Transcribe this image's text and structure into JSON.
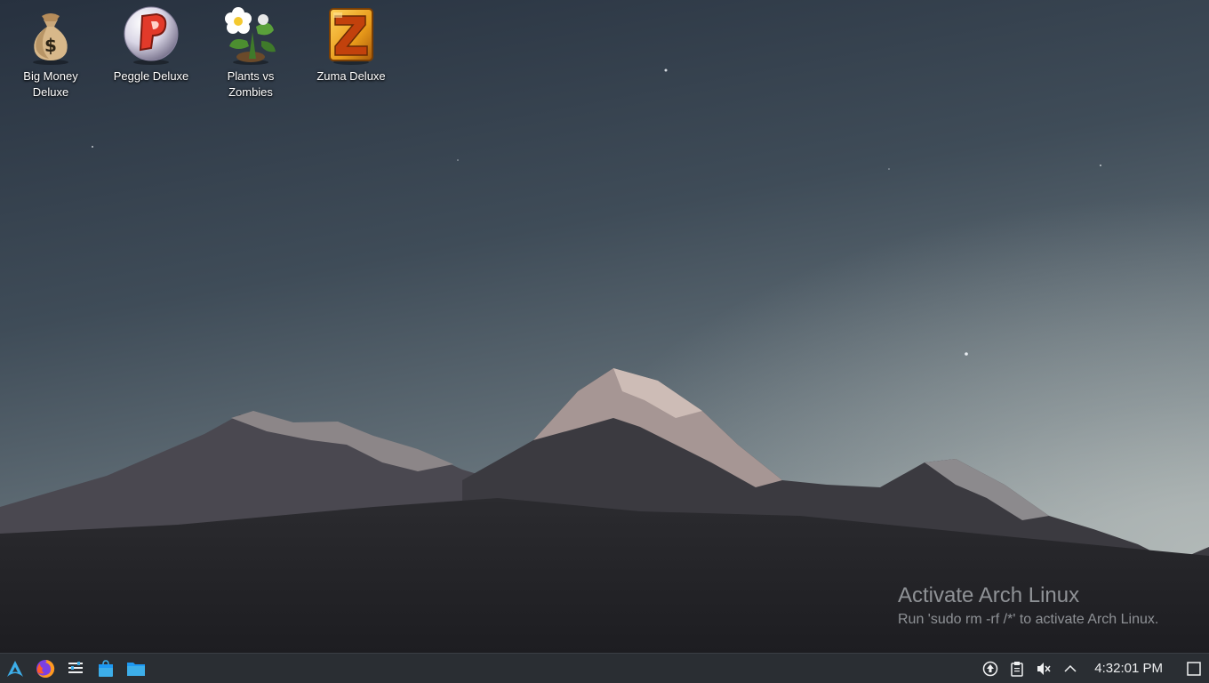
{
  "desktop": {
    "icons": [
      {
        "label": "Big Money\nDeluxe",
        "icon": "money-bag-icon"
      },
      {
        "label": "Peggle Deluxe",
        "icon": "peggle-icon"
      },
      {
        "label": "Plants vs\nZombies",
        "icon": "plants-vs-zombies-icon"
      },
      {
        "label": "Zuma Deluxe",
        "icon": "zuma-icon"
      }
    ],
    "wallpaper": "mountain-at-dusk"
  },
  "watermark": {
    "title": "Activate Arch Linux",
    "subtitle": "Run 'sudo rm -rf /*' to activate Arch Linux."
  },
  "taskbar": {
    "launchers": [
      {
        "icon": "arch-menu-icon"
      },
      {
        "icon": "firefox-icon"
      },
      {
        "icon": "settings-panel-icon"
      },
      {
        "icon": "store-icon"
      },
      {
        "icon": "file-manager-icon"
      }
    ],
    "tray": [
      {
        "icon": "update-icon"
      },
      {
        "icon": "clipboard-icon"
      },
      {
        "icon": "volume-muted-icon"
      },
      {
        "icon": "chevron-up-icon"
      }
    ],
    "clock": "4:32:01 PM"
  },
  "colors": {
    "taskbar_bg": "#2a2e33",
    "sky_top": "#2c3644",
    "sky_bottom": "#8f9a9e",
    "accent_blue": "#3daee9"
  }
}
